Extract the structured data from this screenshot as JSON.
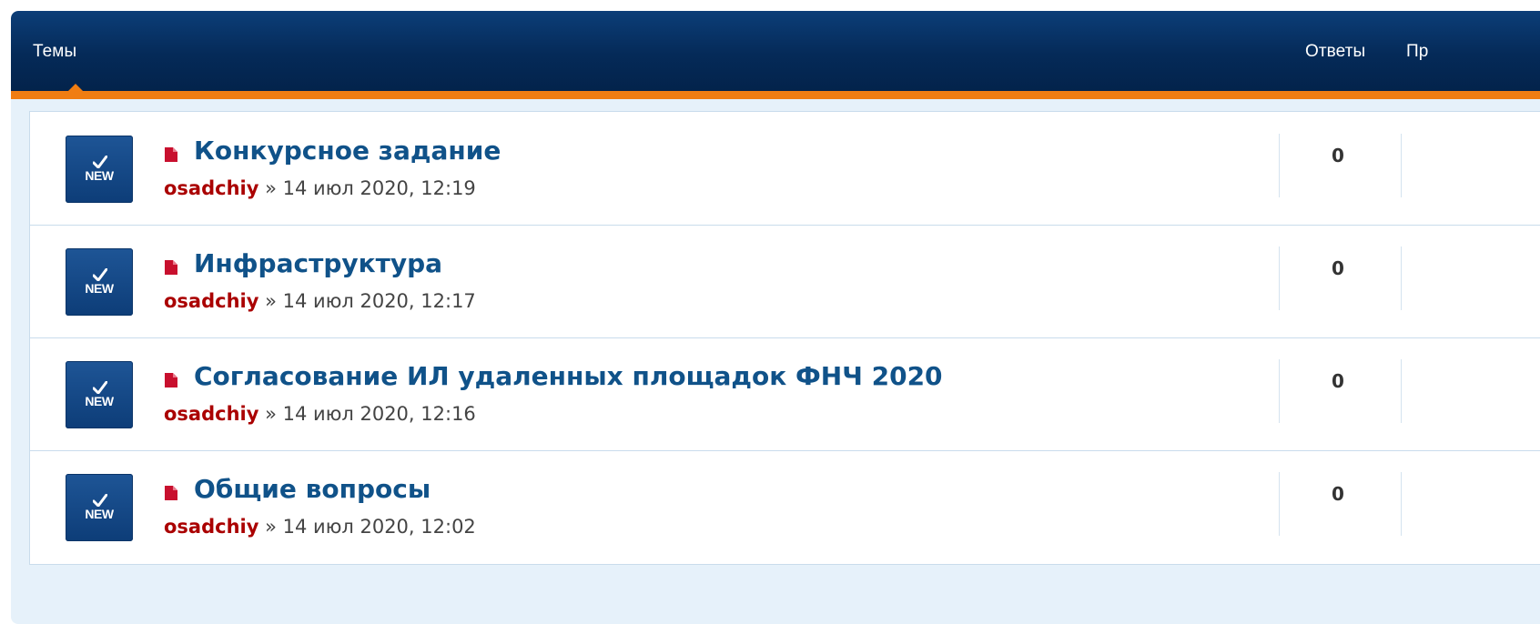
{
  "header": {
    "topics_label": "Темы",
    "replies_label": "Ответы",
    "views_label_partial": "Пр"
  },
  "topics": [
    {
      "title": "Конкурсное задание",
      "author": "osadchiy",
      "separator": "»",
      "date": "14 июл 2020, 12:19",
      "replies": "0",
      "badge": "NEW"
    },
    {
      "title": "Инфраструктура",
      "author": "osadchiy",
      "separator": "»",
      "date": "14 июл 2020, 12:17",
      "replies": "0",
      "badge": "NEW"
    },
    {
      "title": "Согласование ИЛ удаленных площадок ФНЧ 2020",
      "author": "osadchiy",
      "separator": "»",
      "date": "14 июл 2020, 12:16",
      "replies": "0",
      "badge": "NEW"
    },
    {
      "title": "Общие вопросы",
      "author": "osadchiy",
      "separator": "»",
      "date": "14 июл 2020, 12:02",
      "replies": "0",
      "badge": "NEW"
    }
  ],
  "colors": {
    "header_bg": "#052a58",
    "header_accent": "#f07d12",
    "title_link": "#105289",
    "author_link": "#aa0000",
    "doc_icon": "#c8102e"
  },
  "icons": {
    "topic_status": "new-topic-icon",
    "topic_type": "document-icon"
  }
}
